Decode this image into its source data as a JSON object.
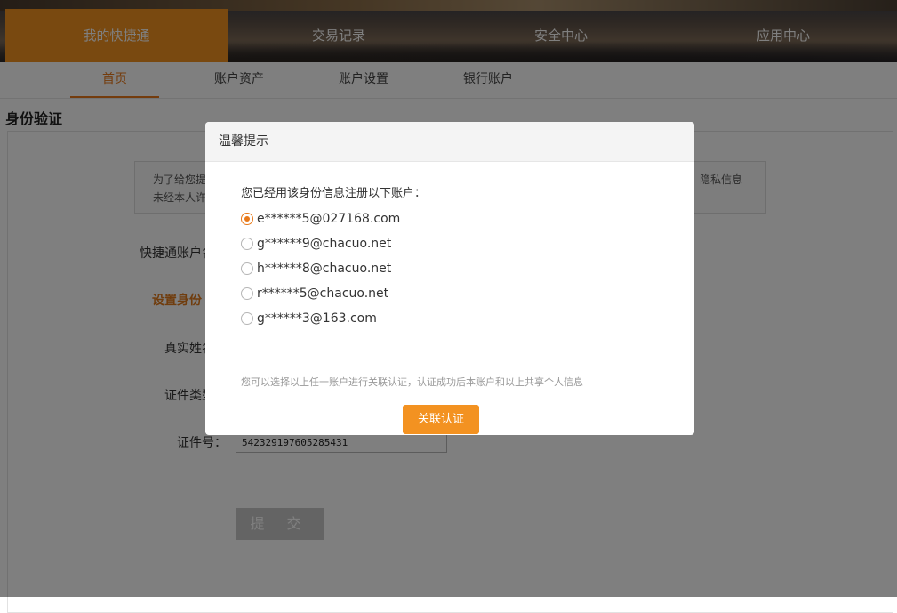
{
  "top_nav": {
    "tabs": [
      {
        "label": "我的快捷通"
      },
      {
        "label": "交易记录"
      },
      {
        "label": "安全中心"
      },
      {
        "label": "应用中心"
      }
    ]
  },
  "sub_nav": {
    "items": [
      {
        "label": "首页"
      },
      {
        "label": "账户资产"
      },
      {
        "label": "账户设置"
      },
      {
        "label": "银行账户"
      }
    ]
  },
  "page": {
    "title": "身份验证",
    "notice": {
      "line1": "为了给您提",
      "line2": "未经本人许",
      "right": "隐私信息"
    },
    "account_label": "快捷通账户名",
    "section_title": "设置身份",
    "realname_label": "真实姓名",
    "idtype_label": "证件类型",
    "idnumber_label": "证件号：",
    "idnumber_value": "542329197605285431",
    "submit_label": "提 交"
  },
  "modal": {
    "title": "温馨提示",
    "intro": "您已经用该身份信息注册以下账户：",
    "accounts": [
      {
        "email": "e******5@027168.com",
        "checked": true
      },
      {
        "email": "g******9@chacuo.net",
        "checked": false
      },
      {
        "email": "h******8@chacuo.net",
        "checked": false
      },
      {
        "email": "r******5@chacuo.net",
        "checked": false
      },
      {
        "email": "g******3@163.com",
        "checked": false
      }
    ],
    "hint": "您可以选择以上任一账户进行关联认证，认证成功后本账户和以上共享个人信息",
    "confirm_label": "关联认证"
  },
  "colors": {
    "accent": "#f39221",
    "accent_text": "#e8791a",
    "overlay": "rgba(0,0,0,0.5)"
  }
}
